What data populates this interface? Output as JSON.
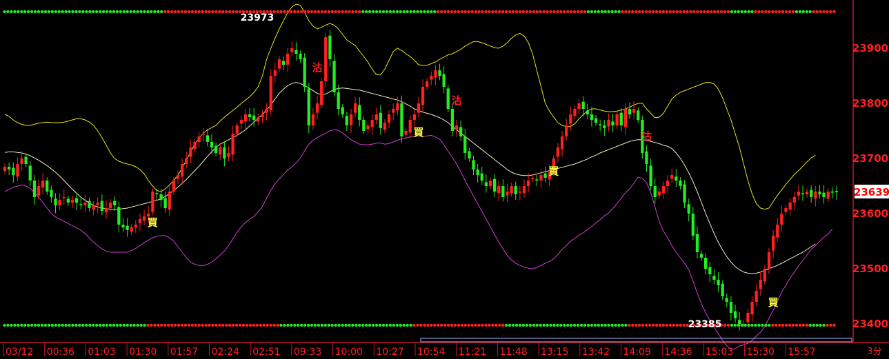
{
  "chart_data": {
    "type": "candlestick",
    "y_ticks": [
      23400,
      23500,
      23600,
      23700,
      23800,
      23900
    ],
    "ylim": [
      23370,
      23985
    ],
    "x_ticks": [
      "03/12",
      "00:36",
      "01:03",
      "01:30",
      "01:57",
      "02:24",
      "02:51",
      "09:33",
      "10:00",
      "10:27",
      "10:54",
      "11:21",
      "11:48",
      "13:15",
      "13:42",
      "14:09",
      "14:36",
      "15:03",
      "15:30",
      "15:57"
    ],
    "period_label": "3分",
    "last_price": 23639,
    "high_label": "23973",
    "low_label": "23385",
    "signals": [
      {
        "text": "買",
        "bar": 35,
        "price": 23590
      },
      {
        "text": "沽",
        "bar": 74,
        "price": 23866
      },
      {
        "text": "買",
        "bar": 98,
        "price": 23754
      },
      {
        "text": "沽",
        "bar": 107,
        "price": 23806
      },
      {
        "text": "買",
        "bar": 130,
        "price": 23683
      },
      {
        "text": "沽",
        "bar": 152,
        "price": 23742
      },
      {
        "text": "買",
        "bar": 182,
        "price": 23445
      }
    ],
    "colors": {
      "up": "#ff2020",
      "down": "#22ee22",
      "upper_band": "#e6e619",
      "middle_band": "#f2f2c8",
      "lower_band": "#d040d0",
      "axis": "#cc1133",
      "tick_text": "#ff2020",
      "dot_green": "#22ee22",
      "dot_red": "#ff2020"
    },
    "close": [
      23685,
      23680,
      23670,
      23690,
      23700,
      23690,
      23660,
      23630,
      23650,
      23660,
      23640,
      23630,
      23615,
      23625,
      23630,
      23620,
      23625,
      23620,
      23615,
      23620,
      23610,
      23615,
      23620,
      23605,
      23610,
      23620,
      23615,
      23580,
      23575,
      23570,
      23575,
      23580,
      23590,
      23595,
      23600,
      23640,
      23635,
      23625,
      23610,
      23640,
      23660,
      23670,
      23690,
      23700,
      23720,
      23730,
      23740,
      23745,
      23730,
      23720,
      23710,
      23720,
      23700,
      23710,
      23745,
      23760,
      23770,
      23780,
      23775,
      23770,
      23775,
      23780,
      23790,
      23850,
      23860,
      23880,
      23870,
      23890,
      23900,
      23890,
      23880,
      23830,
      23760,
      23780,
      23800,
      23840,
      23920,
      23880,
      23820,
      23790,
      23780,
      23760,
      23780,
      23800,
      23770,
      23750,
      23760,
      23770,
      23780,
      23755,
      23765,
      23780,
      23790,
      23800,
      23740,
      23750,
      23770,
      23780,
      23800,
      23830,
      23840,
      23850,
      23860,
      23850,
      23830,
      23790,
      23750,
      23760,
      23740,
      23710,
      23700,
      23680,
      23670,
      23660,
      23650,
      23660,
      23640,
      23650,
      23630,
      23640,
      23650,
      23635,
      23640,
      23650,
      23660,
      23665,
      23660,
      23670,
      23665,
      23675,
      23700,
      23720,
      23740,
      23760,
      23780,
      23790,
      23800,
      23790,
      23780,
      23770,
      23765,
      23760,
      23755,
      23770,
      23760,
      23780,
      23760,
      23790,
      23780,
      23790,
      23770,
      23710,
      23690,
      23650,
      23630,
      23640,
      23650,
      23660,
      23670,
      23660,
      23650,
      23620,
      23600,
      23560,
      23530,
      23520,
      23500,
      23490,
      23480,
      23470,
      23450,
      23440,
      23420,
      23410,
      23400,
      23400,
      23420,
      23440,
      23460,
      23480,
      23500,
      23530,
      23560,
      23580,
      23600,
      23610,
      23620,
      23630,
      23640,
      23635,
      23640,
      23630,
      23640,
      23635,
      23630,
      23640,
      23638,
      23639
    ],
    "upper_band": [
      23780,
      23776,
      23770,
      23765,
      23762,
      23760,
      23760,
      23762,
      23764,
      23765,
      23766,
      23765,
      23765,
      23765,
      23766,
      23768,
      23770,
      23772,
      23772,
      23770,
      23766,
      23760,
      23750,
      23738,
      23724,
      23710,
      23700,
      23695,
      23692,
      23690,
      23688,
      23685,
      23680,
      23672,
      23660,
      23650,
      23642,
      23640,
      23645,
      23652,
      23660,
      23670,
      23683,
      23697,
      23712,
      23726,
      23737,
      23746,
      23752,
      23756,
      23760,
      23768,
      23775,
      23781,
      23787,
      23793,
      23800,
      23806,
      23812,
      23820,
      23830,
      23850,
      23880,
      23900,
      23918,
      23935,
      23950,
      23965,
      23975,
      23980,
      23978,
      23965,
      23950,
      23940,
      23935,
      23938,
      23942,
      23945,
      23942,
      23935,
      23925,
      23915,
      23910,
      23905,
      23895,
      23885,
      23875,
      23862,
      23852,
      23852,
      23862,
      23878,
      23894,
      23900,
      23896,
      23890,
      23885,
      23878,
      23870,
      23869,
      23869,
      23872,
      23875,
      23880,
      23884,
      23888,
      23890,
      23894,
      23898,
      23904,
      23908,
      23912,
      23912,
      23910,
      23907,
      23904,
      23901,
      23900,
      23904,
      23910,
      23918,
      23924,
      23927,
      23922,
      23910,
      23890,
      23860,
      23830,
      23800,
      23786,
      23775,
      23765,
      23760,
      23758,
      23758,
      23763,
      23772,
      23780,
      23786,
      23790,
      23790,
      23788,
      23786,
      23785,
      23785,
      23786,
      23788,
      23790,
      23793,
      23797,
      23800,
      23800,
      23790,
      23782,
      23774,
      23775,
      23782,
      23795,
      23808,
      23815,
      23820,
      23823,
      23826,
      23829,
      23832,
      23835,
      23838,
      23838,
      23835,
      23826,
      23810,
      23790,
      23770,
      23745,
      23720,
      23690,
      23660,
      23636,
      23618,
      23610,
      23608,
      23610,
      23622,
      23633,
      23643,
      23653,
      23662,
      23671,
      23678,
      23686,
      23694,
      23701,
      23706
    ],
    "middle_band": [
      23711,
      23712,
      23712,
      23711,
      23710,
      23708,
      23705,
      23701,
      23697,
      23692,
      23687,
      23681,
      23675,
      23668,
      23660,
      23652,
      23644,
      23637,
      23630,
      23624,
      23619,
      23615,
      23612,
      23610,
      23609,
      23608,
      23608,
      23608,
      23609,
      23610,
      23612,
      23614,
      23616,
      23618,
      23620,
      23622,
      23624,
      23627,
      23631,
      23636,
      23642,
      23648,
      23655,
      23662,
      23670,
      23678,
      23686,
      23695,
      23704,
      23712,
      23720,
      23726,
      23730,
      23734,
      23738,
      23742,
      23747,
      23752,
      23759,
      23766,
      23773,
      23780,
      23788,
      23797,
      23808,
      23818,
      23826,
      23832,
      23836,
      23838,
      23836,
      23832,
      23828,
      23823,
      23818,
      23816,
      23817,
      23821,
      23825,
      23827,
      23828,
      23827,
      23826,
      23825,
      23824,
      23822,
      23820,
      23818,
      23816,
      23814,
      23812,
      23810,
      23808,
      23806,
      23803,
      23799,
      23795,
      23790,
      23787,
      23784,
      23782,
      23780,
      23777,
      23774,
      23770,
      23765,
      23758,
      23752,
      23746,
      23740,
      23734,
      23728,
      23722,
      23716,
      23710,
      23704,
      23698,
      23692,
      23686,
      23680,
      23675,
      23672,
      23670,
      23669,
      23669,
      23670,
      23672,
      23674,
      23676,
      23678,
      23680,
      23682,
      23684,
      23686,
      23688,
      23690,
      23693,
      23696,
      23699,
      23703,
      23706,
      23710,
      23713,
      23716,
      23719,
      23722,
      23725,
      23728,
      23731,
      23733,
      23734,
      23734,
      23733,
      23731,
      23729,
      23727,
      23724,
      23722,
      23718,
      23710,
      23700,
      23688,
      23674,
      23658,
      23640,
      23620,
      23600,
      23582,
      23564,
      23548,
      23534,
      23522,
      23512,
      23504,
      23498,
      23494,
      23492,
      23491,
      23492,
      23494,
      23497,
      23500,
      23503,
      23506,
      23510,
      23514,
      23518,
      23522,
      23526,
      23530,
      23535,
      23540,
      23545
    ],
    "lower_band": [
      23640,
      23644,
      23648,
      23650,
      23652,
      23650,
      23646,
      23638,
      23630,
      23620,
      23610,
      23600,
      23594,
      23590,
      23586,
      23582,
      23578,
      23574,
      23570,
      23564,
      23556,
      23548,
      23542,
      23536,
      23532,
      23530,
      23530,
      23530,
      23530,
      23530,
      23533,
      23537,
      23542,
      23547,
      23552,
      23556,
      23559,
      23560,
      23560,
      23556,
      23550,
      23540,
      23530,
      23520,
      23512,
      23508,
      23506,
      23506,
      23508,
      23512,
      23518,
      23525,
      23532,
      23542,
      23554,
      23566,
      23576,
      23584,
      23590,
      23595,
      23603,
      23613,
      23628,
      23642,
      23654,
      23663,
      23671,
      23679,
      23685,
      23692,
      23701,
      23714,
      23726,
      23733,
      23738,
      23742,
      23746,
      23750,
      23752,
      23751,
      23746,
      23740,
      23734,
      23730,
      23726,
      23725,
      23725,
      23726,
      23728,
      23728,
      23726,
      23727,
      23730,
      23733,
      23736,
      23737,
      23739,
      23740,
      23741,
      23740,
      23741,
      23742,
      23739,
      23735,
      23725,
      23713,
      23702,
      23690,
      23676,
      23660,
      23646,
      23632,
      23618,
      23604,
      23590,
      23576,
      23562,
      23548,
      23536,
      23524,
      23516,
      23510,
      23506,
      23503,
      23501,
      23500,
      23502,
      23506,
      23510,
      23513,
      23518,
      23526,
      23535,
      23542,
      23550,
      23555,
      23561,
      23565,
      23571,
      23577,
      23583,
      23589,
      23596,
      23601,
      23609,
      23618,
      23628,
      23638,
      23645,
      23655,
      23666,
      23664,
      23656,
      23638,
      23612,
      23586,
      23568,
      23556,
      23542,
      23530,
      23520,
      23510,
      23498,
      23478,
      23456,
      23436,
      23420,
      23406,
      23394,
      23382,
      23370,
      23360,
      23354,
      23355,
      23360,
      23362,
      23365,
      23370,
      23378,
      23385,
      23395,
      23410,
      23425,
      23440,
      23458,
      23470,
      23483,
      23494,
      23505,
      23515,
      23525,
      23535,
      23542,
      23550,
      23557,
      23563,
      23572
    ]
  }
}
